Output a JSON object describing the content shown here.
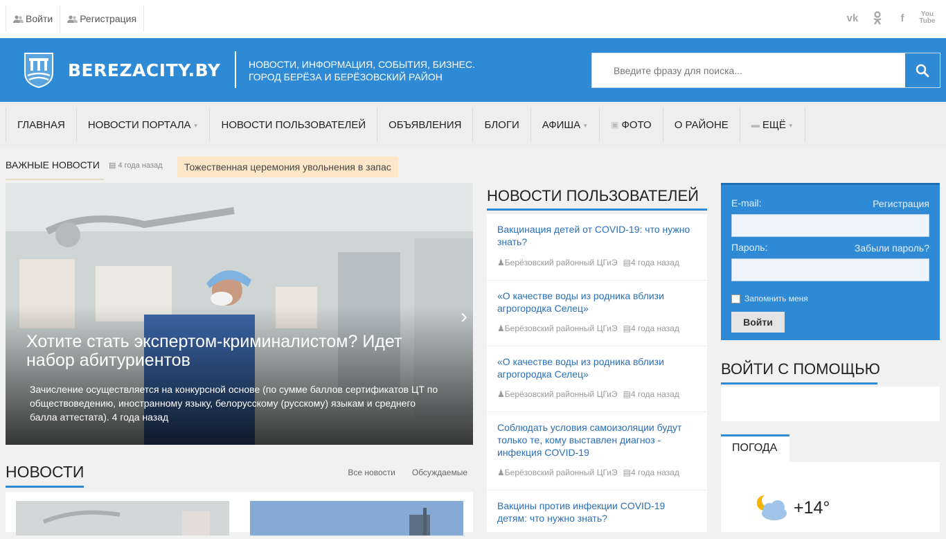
{
  "topbar": {
    "login_label": "Войти",
    "register_label": "Регистрация",
    "social": [
      "vk-icon",
      "odnoklassniki-icon",
      "facebook-icon",
      "youtube-icon"
    ]
  },
  "header": {
    "brand": "BEREZACITY.BY",
    "tagline_line1": "НОВОСТИ, ИНФОРМАЦИЯ, СОБЫТИЯ, БИЗНЕС.",
    "tagline_line2": "ГОРОД БЕРЁЗА И БЕРЁЗОВСКИЙ РАЙОН",
    "search_placeholder": "Введите фразу для поиска...",
    "accent_color": "#2e8ad5"
  },
  "nav": {
    "items": [
      {
        "label": "ГЛАВНАЯ"
      },
      {
        "label": "НОВОСТИ ПОРТАЛА"
      },
      {
        "label": "НОВОСТИ ПОЛЬЗОВАТЕЛЕЙ"
      },
      {
        "label": "ОБЪЯВЛЕНИЯ"
      },
      {
        "label": "БЛОГИ"
      },
      {
        "label": "АФИША"
      },
      {
        "label": "ФОТО"
      },
      {
        "label": "О РАЙОНЕ"
      },
      {
        "label": "ЕЩЁ"
      }
    ]
  },
  "breaking": {
    "label": "ВАЖНЫЕ НОВОСТИ",
    "time": "4 года назад",
    "headline": "Тожественная церемония увольнения в запас"
  },
  "slider": {
    "title": "Хотите стать экспертом-криминалистом? Идет набор абитуриентов",
    "desc": "Зачисление осуществляется на конкурсной основе (по сумме баллов сертификатов ЦТ по обществоведению, иностранному языку, белорусскому (русскому) языкам и среднего балла аттестата). 4 года назад"
  },
  "news": {
    "heading": "НОВОСТИ",
    "tab_all": "Все новости",
    "tab_discussed": "Обсуждаемые"
  },
  "user_news": {
    "heading": "НОВОСТИ ПОЛЬЗОВАТЕЛЕЙ",
    "items": [
      {
        "title": "Вакцинация детей от COVID-19: что нужно знать?",
        "author": "Берёзовский районный ЦГиЭ",
        "time": "4 года назад"
      },
      {
        "title": "«О качестве воды из родника вблизи агрогородка Селец»",
        "author": "Берёзовский районный ЦГиЭ",
        "time": "4 года назад"
      },
      {
        "title": "«О качестве воды из родника вблизи агрогородка Селец»",
        "author": "Берёзовский районный ЦГиЭ",
        "time": "4 года назад"
      },
      {
        "title": "Соблюдать условия самоизоляции будут только те, кому выставлен диагноз - инфекция COVID-19",
        "author": "Берёзовский районный ЦГиЭ",
        "time": "4 года назад"
      },
      {
        "title": "Вакцины против инфекции COVID-19 детям: что нужно знать?",
        "author": "",
        "time": ""
      }
    ]
  },
  "login": {
    "email_label": "E-mail:",
    "register_link": "Регистрация",
    "password_label": "Пароль:",
    "forgot_link": "Забыли пароль?",
    "remember_label": "Запомнить меня",
    "submit_label": "Войти"
  },
  "social_login": {
    "heading": "ВОЙТИ С ПОМОЩЬЮ"
  },
  "weather": {
    "tab": "ПОГОДА",
    "temp": "+14°",
    "icon": "partly-cloudy-night-icon"
  }
}
